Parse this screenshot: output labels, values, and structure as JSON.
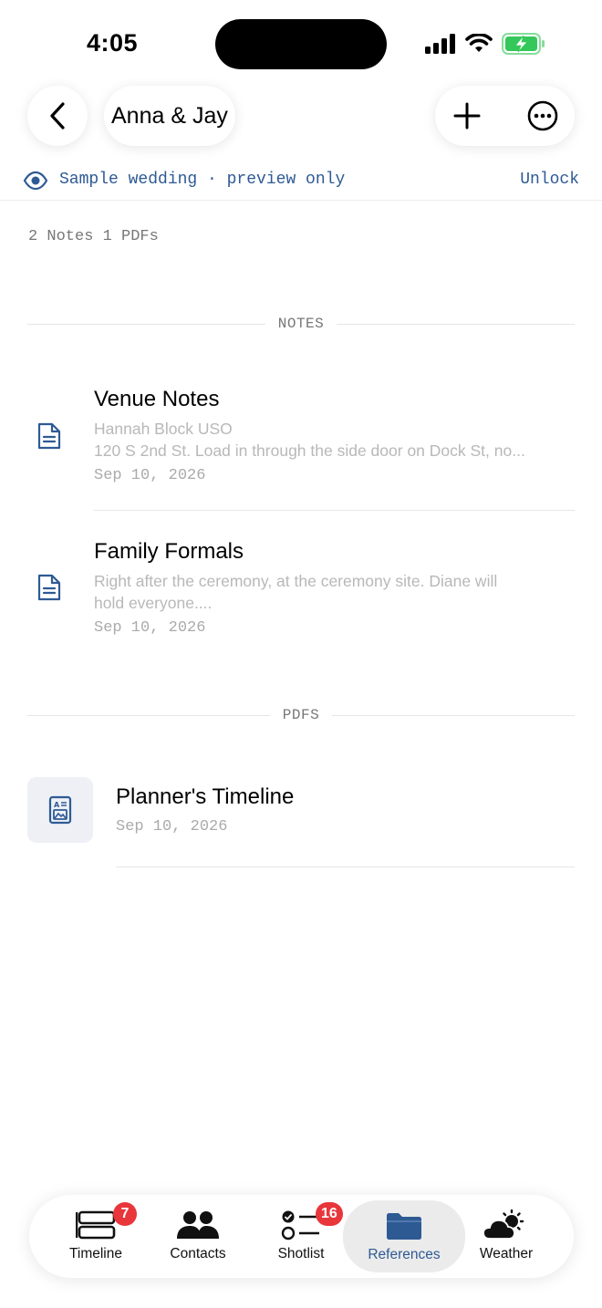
{
  "status": {
    "time": "4:05"
  },
  "header": {
    "title": "Anna & Jay"
  },
  "banner": {
    "message": "Sample wedding · preview only",
    "action": "Unlock"
  },
  "counts": "2 Notes 1 PDFs",
  "sections": {
    "notes": "NOTES",
    "pdfs": "PDFS"
  },
  "notes": [
    {
      "title": "Venue Notes",
      "line1": "Hannah Block USO",
      "line2": "120 S 2nd St. Load in through the side door on Dock St, no...",
      "date": "Sep 10, 2026"
    },
    {
      "title": "Family Formals",
      "line1": "Right after the ceremony, at the ceremony site. Diane will",
      "line2": "hold everyone....",
      "date": "Sep 10, 2026"
    }
  ],
  "pdfs": [
    {
      "title": "Planner's Timeline",
      "date": "Sep 10, 2026"
    }
  ],
  "tabs": [
    {
      "label": "Timeline",
      "badge": "7"
    },
    {
      "label": "Contacts"
    },
    {
      "label": "Shotlist",
      "badge": "16"
    },
    {
      "label": "References",
      "active": true
    },
    {
      "label": "Weather"
    }
  ],
  "colors": {
    "accent": "#2e5a94",
    "badge": "#e8363a",
    "battery": "#34c759"
  }
}
